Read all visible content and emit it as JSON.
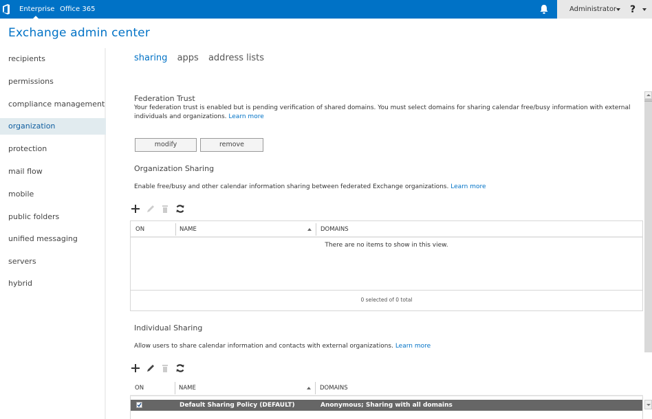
{
  "topbar": {
    "nav": [
      "Enterprise",
      "Office 365"
    ],
    "active_nav": "Enterprise",
    "user": "Administrator",
    "help": "?",
    "icons": {
      "logo": "office-logo-icon",
      "notifications": "bell-icon"
    }
  },
  "app": {
    "title": "Exchange admin center"
  },
  "sidebar": {
    "items": [
      {
        "label": "recipients"
      },
      {
        "label": "permissions"
      },
      {
        "label": "compliance management"
      },
      {
        "label": "organization",
        "active": true
      },
      {
        "label": "protection"
      },
      {
        "label": "mail flow"
      },
      {
        "label": "mobile"
      },
      {
        "label": "public folders"
      },
      {
        "label": "unified messaging"
      },
      {
        "label": "servers"
      },
      {
        "label": "hybrid"
      }
    ]
  },
  "tabs": [
    {
      "label": "sharing",
      "active": true
    },
    {
      "label": "apps"
    },
    {
      "label": "address lists"
    }
  ],
  "federation": {
    "title": "Federation Trust",
    "description": "Your federation trust is enabled but is pending verification of shared domains. You must select domains for sharing calendar free/busy information with external individuals and organizations.",
    "learn_more": "Learn more",
    "modify_label": "modify",
    "remove_label": "remove"
  },
  "org_sharing": {
    "title": "Organization Sharing",
    "description": "Enable free/busy and other calendar information sharing between federated Exchange organizations.",
    "learn_more": "Learn more",
    "toolbar": [
      "add-icon",
      "edit-icon",
      "delete-icon",
      "refresh-icon"
    ],
    "columns": [
      "ON",
      "NAME",
      "DOMAINS"
    ],
    "empty_message": "There are no items to show in this view.",
    "footer": "0 selected of 0 total"
  },
  "individual_sharing": {
    "title": "Individual Sharing",
    "description": "Allow users to share calendar information and contacts with external organizations.",
    "learn_more": "Learn more",
    "toolbar": [
      "add-icon",
      "edit-icon",
      "delete-icon",
      "refresh-icon"
    ],
    "columns": [
      "ON",
      "NAME",
      "DOMAINS"
    ],
    "rows": [
      {
        "on": true,
        "name": "Default Sharing Policy (DEFAULT)",
        "domains": "Anonymous; Sharing with all domains",
        "selected": true
      }
    ]
  }
}
